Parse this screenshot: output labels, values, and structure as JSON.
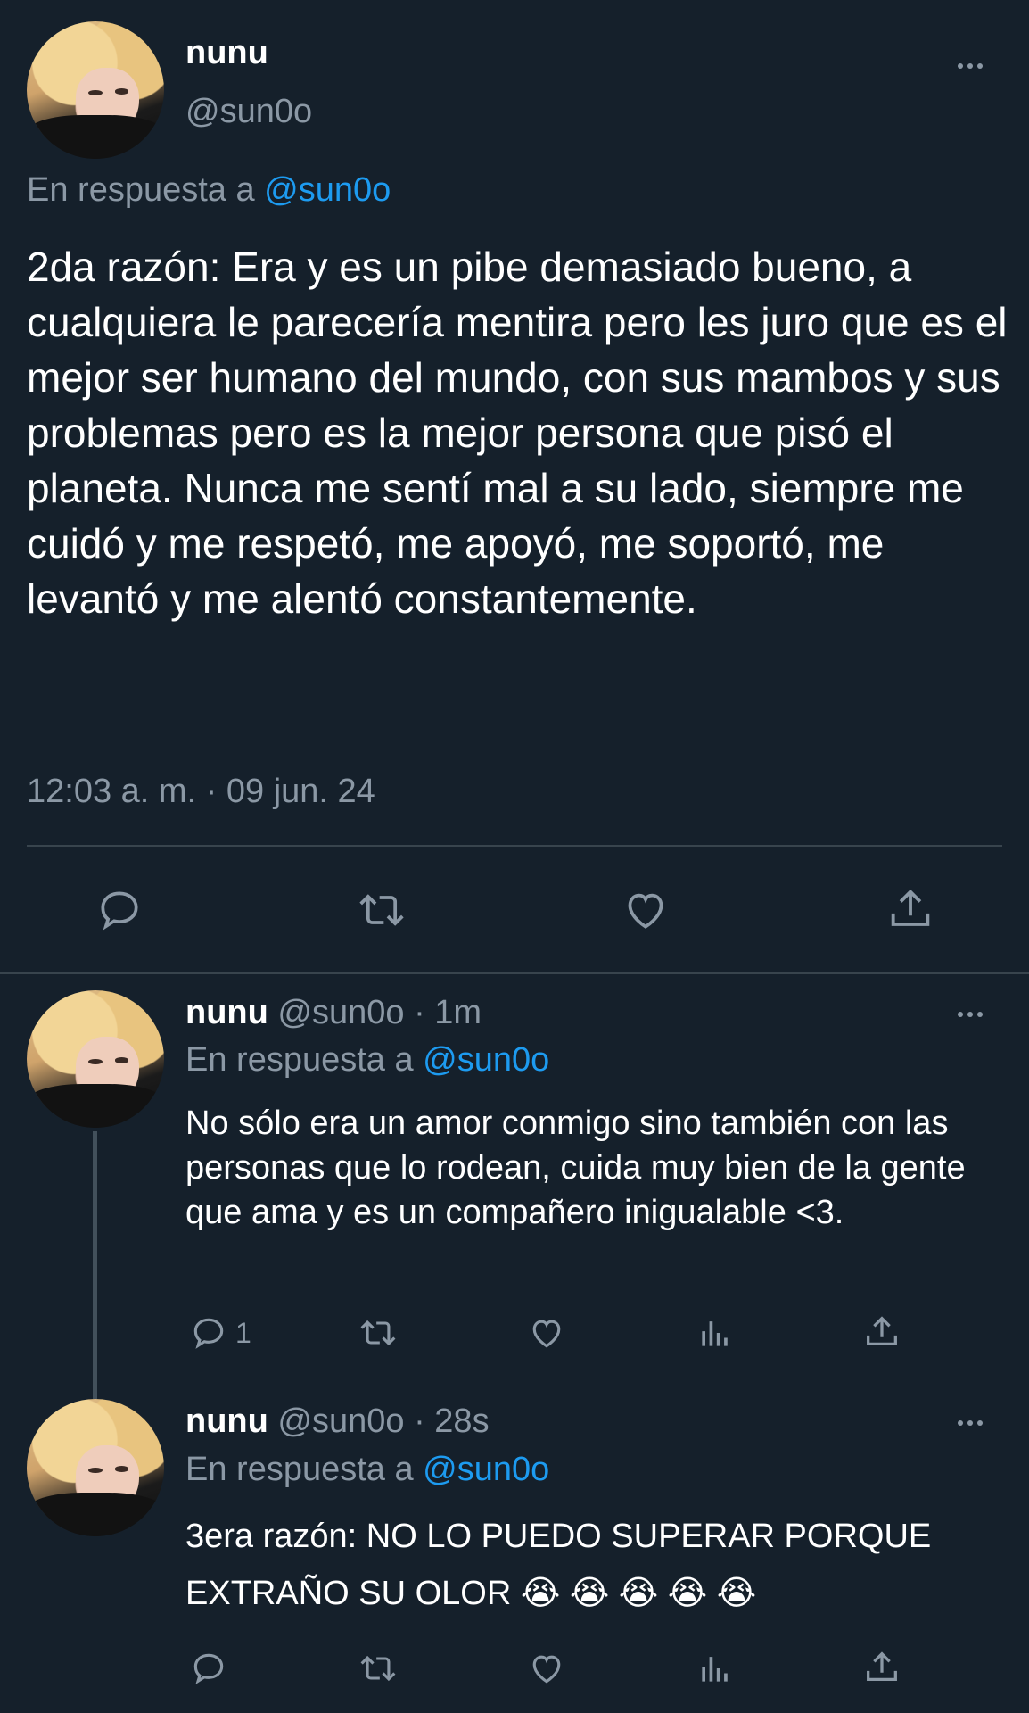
{
  "main_tweet": {
    "display_name": "nunu",
    "handle": "@sun0o",
    "reply_prefix": "En respuesta a",
    "reply_to": "@sun0o",
    "text": "2da razón: Era y es un pibe demasiado bueno, a cualquiera le parecería mentira pero les juro que es el mejor ser humano del mundo, con sus mambos y sus problemas pero es la mejor persona que pisó el planeta. Nunca me sentí mal a su lado, siempre me cuidó y me respetó, me apoyó, me soportó, me levantó y me alentó constantemente.",
    "timestamp": "12:03 a. m. · 09 jun. 24"
  },
  "replies": [
    {
      "display_name": "nunu",
      "meta": "@sun0o · 1m",
      "reply_prefix": "En respuesta a",
      "reply_to": "@sun0o",
      "text": "No sólo era un amor conmigo sino también con las personas que lo rodean, cuida muy bien de la gente que ama y es un compañero inigualable <3.",
      "reply_count": "1"
    },
    {
      "display_name": "nunu",
      "meta": "@sun0o · 28s",
      "reply_prefix": "En respuesta a",
      "reply_to": "@sun0o",
      "text": "3era razón: NO LO PUEDO SUPERAR PORQUE EXTRAÑO SU OLOR",
      "emoji": "😭 😭 😭 😭 😭"
    }
  ],
  "colors": {
    "background": "#15202b",
    "muted": "#8b98a5",
    "accent": "#1d9bf0",
    "divider": "#38444d"
  },
  "icons": [
    "reply-icon",
    "retweet-icon",
    "like-icon",
    "share-icon",
    "views-icon",
    "more-icon"
  ]
}
